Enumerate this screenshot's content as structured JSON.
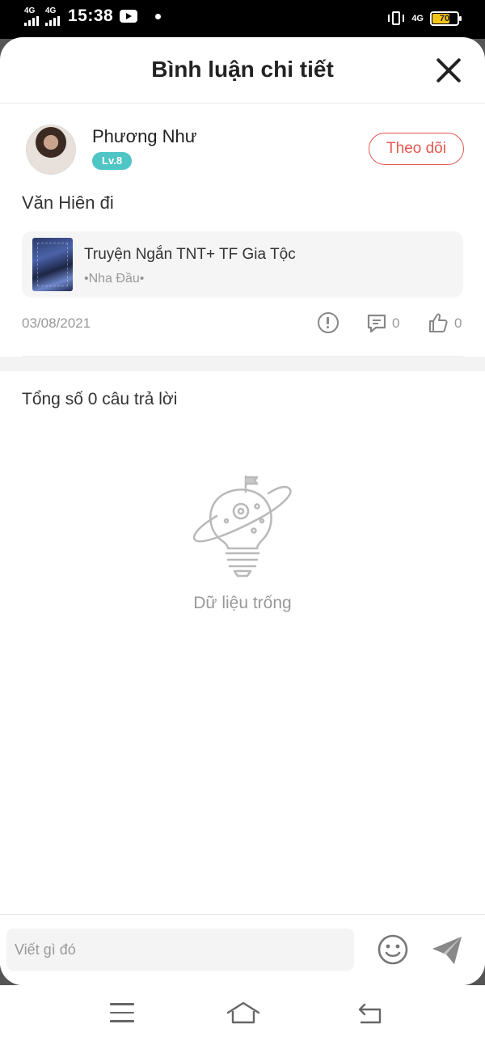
{
  "status_bar": {
    "sim1": "4G",
    "sim2": "4G",
    "time": "15:38",
    "network": "4G",
    "battery_level": "70",
    "battery_fill_percent": 70
  },
  "header": {
    "title": "Bình luận chi tiết"
  },
  "comment": {
    "user_name": "Phương Như",
    "level": "Lv.8",
    "follow_label": "Theo dõi",
    "text": "Văn Hiên đi",
    "book": {
      "title": "Truyện Ngắn TNT+ TF Gia Tộc",
      "author": "•Nha Đầu•"
    },
    "date": "03/08/2021",
    "reply_count": "0",
    "like_count": "0"
  },
  "replies": {
    "total_label": "Tổng số 0 câu trả lời",
    "empty_text": "Dữ liệu trống"
  },
  "composer": {
    "placeholder": "Viết gì đó"
  },
  "colors": {
    "accent": "#e5584f",
    "level_badge": "#4fc5c5"
  },
  "icons": [
    "close-icon",
    "report-icon",
    "reply-icon",
    "like-icon",
    "emoji-icon",
    "send-icon",
    "menu-icon",
    "home-icon",
    "back-icon"
  ]
}
